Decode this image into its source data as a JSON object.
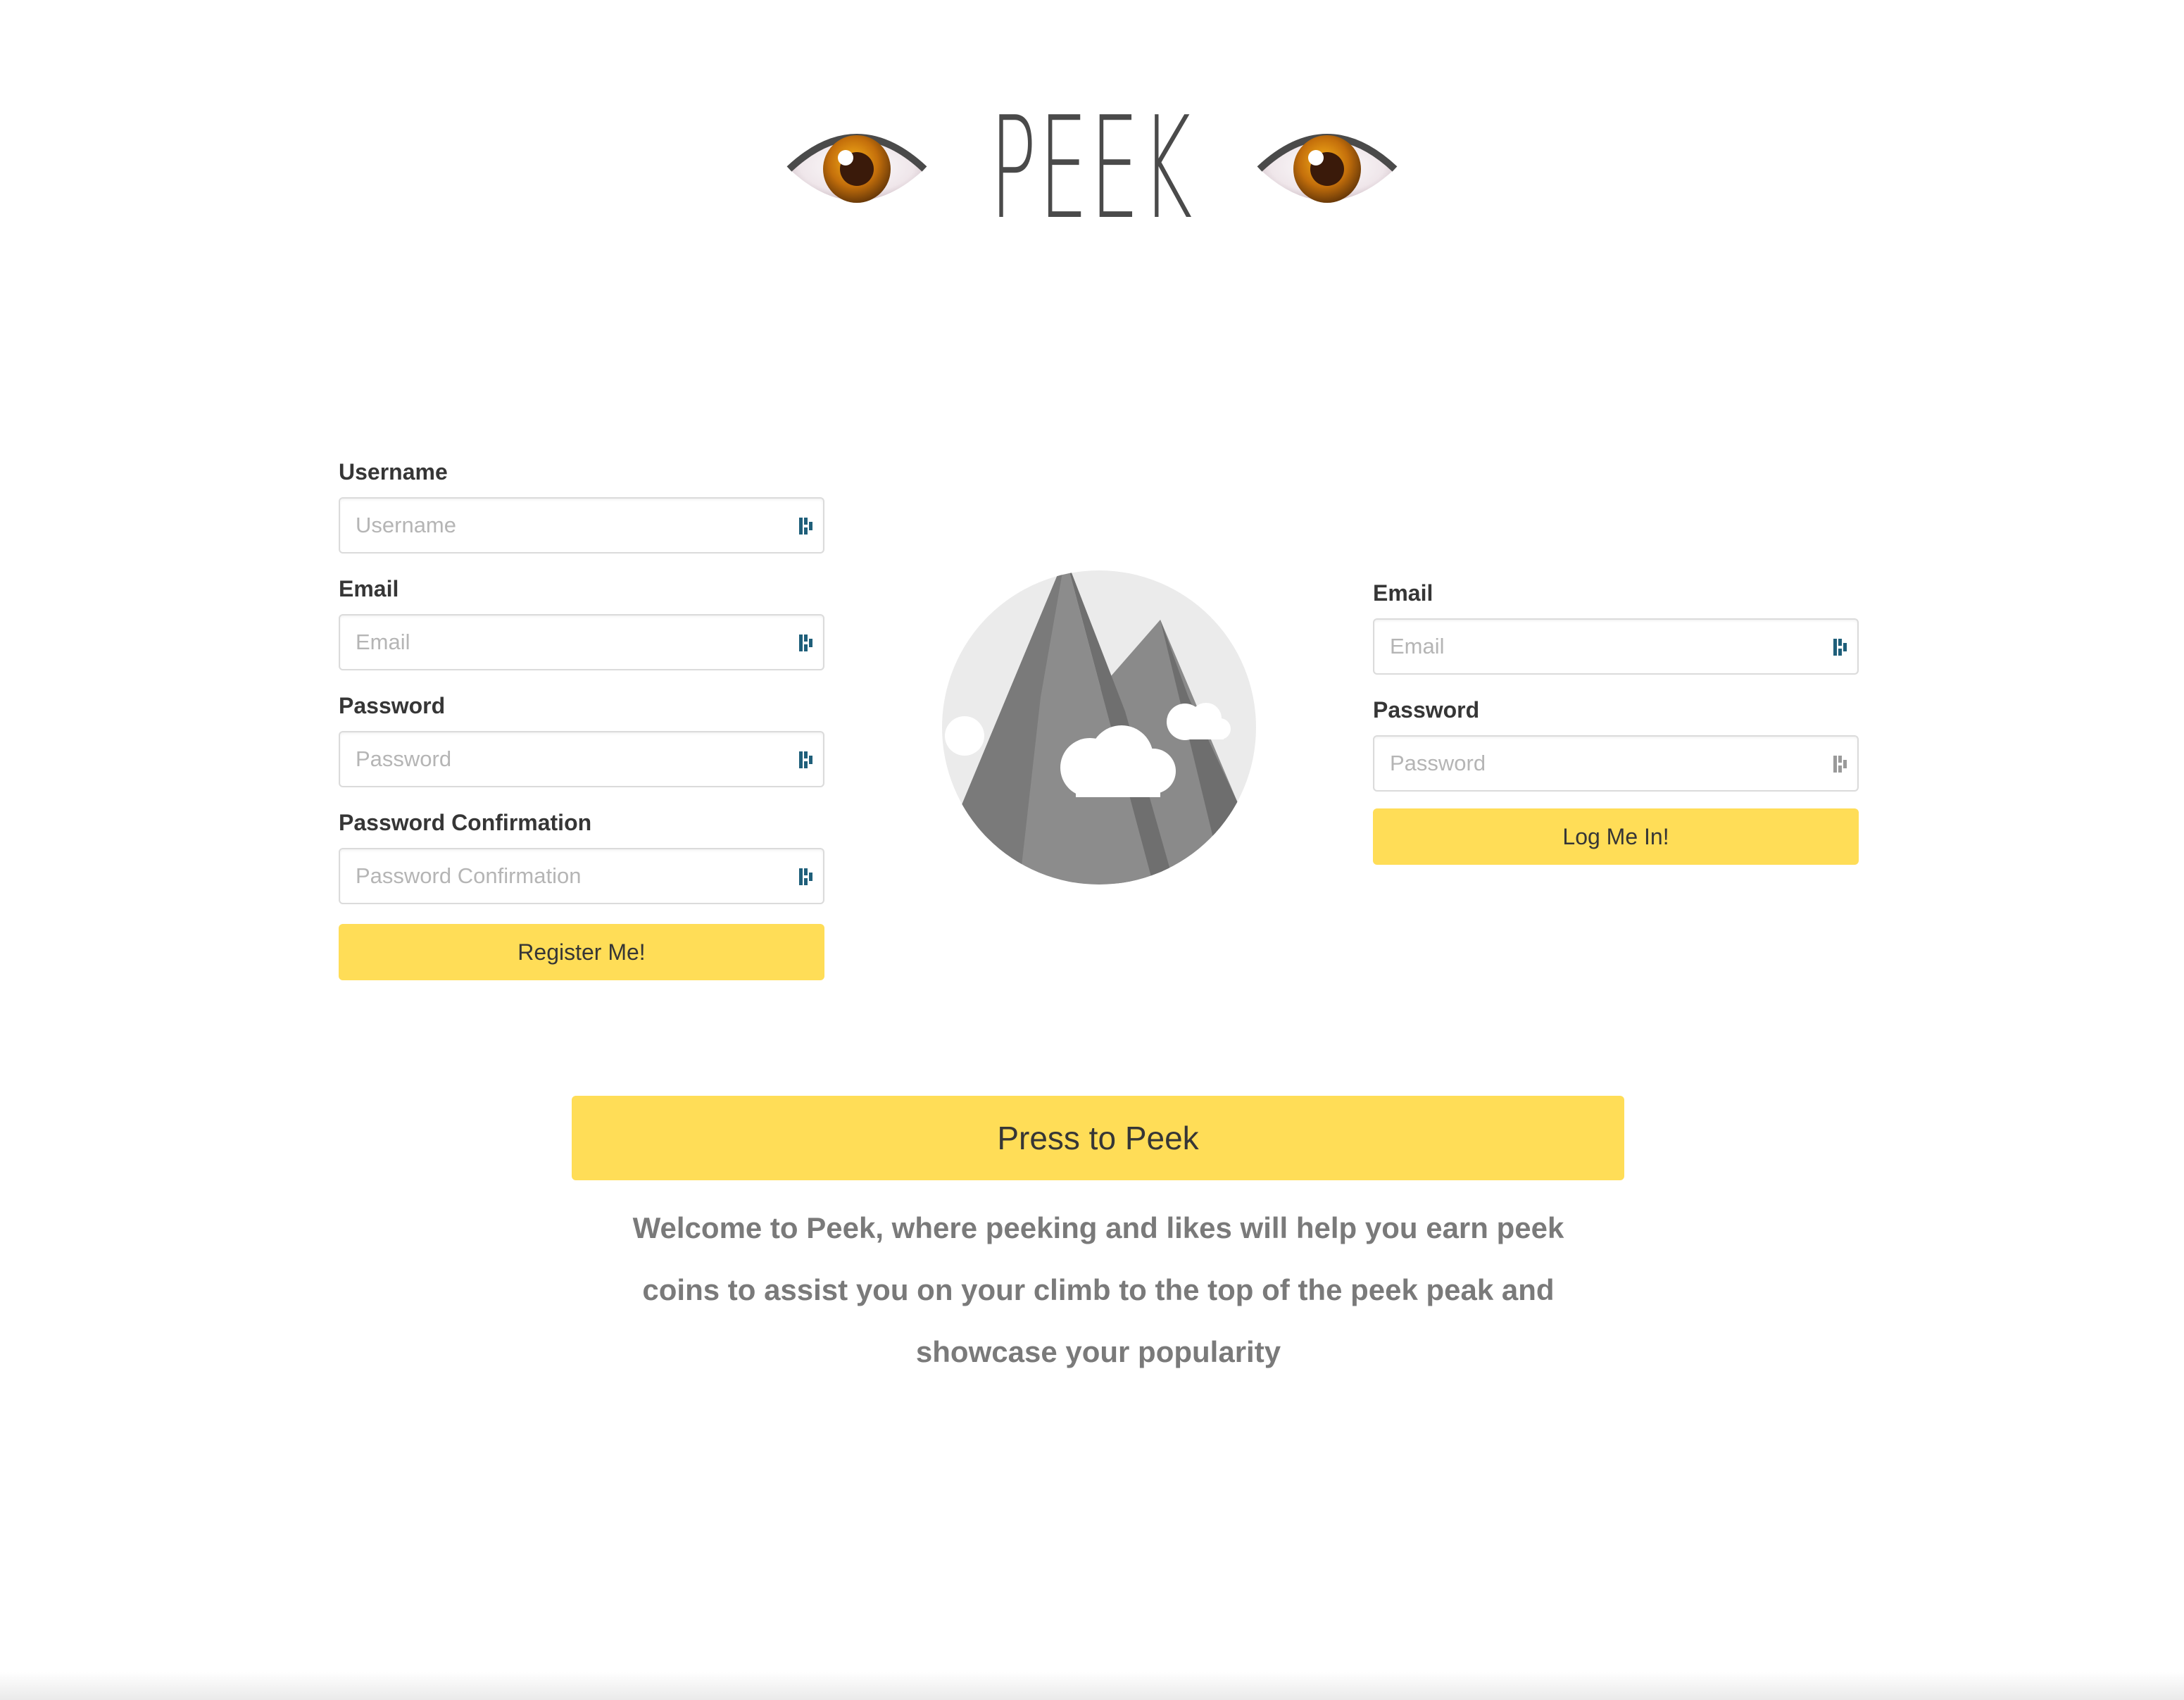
{
  "header": {
    "title": "PEEK",
    "left_icon": "eye-emoji",
    "right_icon": "eye-emoji"
  },
  "register": {
    "username_label": "Username",
    "username_placeholder": "Username",
    "email_label": "Email",
    "email_placeholder": "Email",
    "password_label": "Password",
    "password_placeholder": "Password",
    "confirm_label": "Password Confirmation",
    "confirm_placeholder": "Password Confirmation",
    "submit_label": "Register Me!"
  },
  "center_image": {
    "icon": "mountain-placeholder-image"
  },
  "login": {
    "email_label": "Email",
    "email_placeholder": "Email",
    "password_label": "Password",
    "password_placeholder": "Password",
    "submit_label": "Log Me In!"
  },
  "peek_button": {
    "label": "Press to Peek"
  },
  "welcome": {
    "text": "Welcome to Peek, where peeking and likes will help you earn peek coins to assist you on your climb to the top of the peek peak and showcase your popularity"
  },
  "colors": {
    "button_yellow": "#ffdd57",
    "text_dark": "#363636",
    "text_grey": "#7a7a7a",
    "input_border": "#dbdbdb",
    "placeholder": "#b5b5b5"
  }
}
